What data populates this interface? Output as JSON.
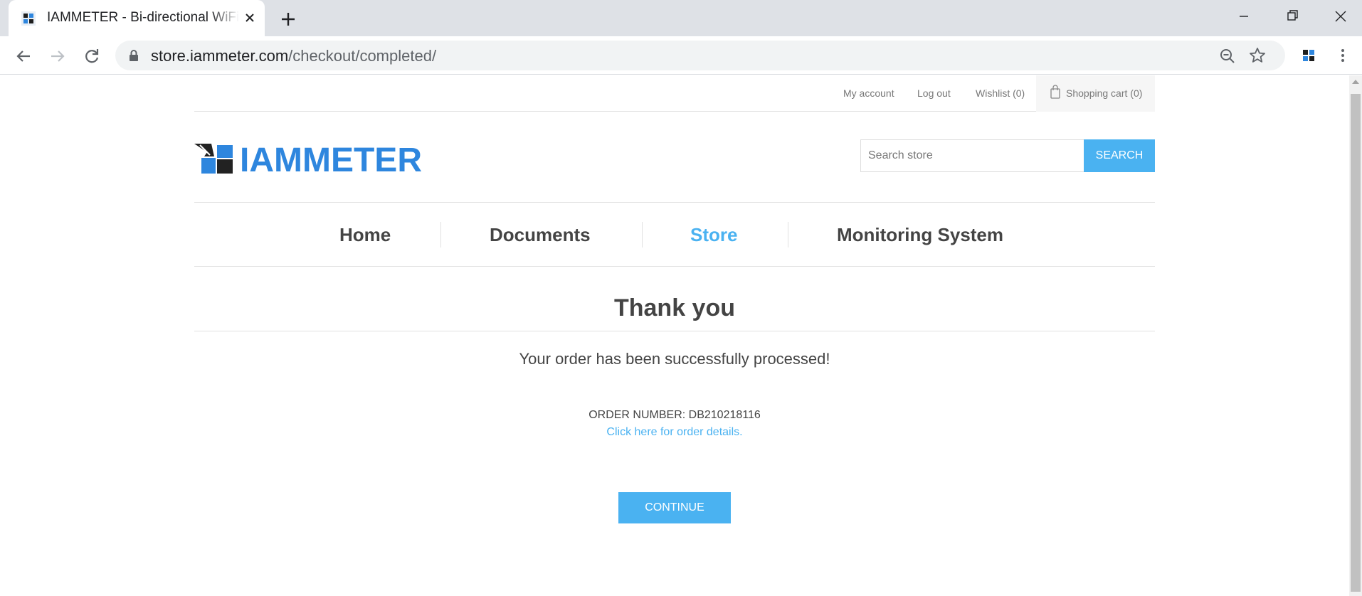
{
  "browser": {
    "tab_title": "IAMMETER - Bi-directional WiFi Energy Meter",
    "url_host": "store.iammeter.com",
    "url_path": "/checkout/completed/"
  },
  "header_links": {
    "my_account": "My account",
    "log_out": "Log out",
    "wishlist": "Wishlist (0)",
    "shopping_cart": "Shopping cart (0)"
  },
  "logo": {
    "text": "IAMMETER"
  },
  "search": {
    "placeholder": "Search store",
    "button_label": "SEARCH"
  },
  "menu": {
    "items": [
      {
        "label": "Home"
      },
      {
        "label": "Documents"
      },
      {
        "label": "Store"
      },
      {
        "label": "Monitoring System"
      }
    ]
  },
  "content": {
    "title": "Thank you",
    "success_message": "Your order has been successfully processed!",
    "order_number": "ORDER NUMBER: DB210218116",
    "order_details_link": "Click here for order details.",
    "continue_label": "CONTINUE"
  },
  "colors": {
    "accent": "#4ab2f1",
    "logo_blue": "#2e86de",
    "text": "#444444"
  }
}
